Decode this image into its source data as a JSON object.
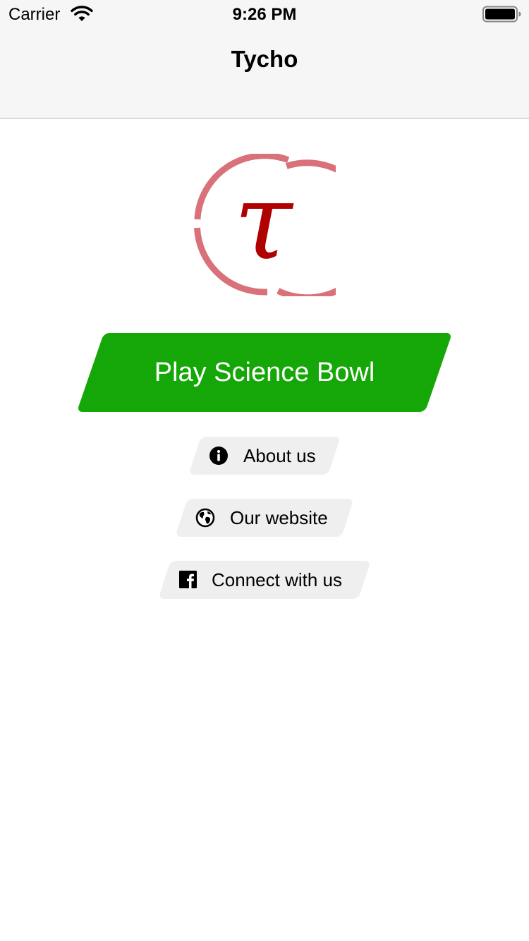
{
  "status_bar": {
    "carrier": "Carrier",
    "time": "9:26 PM"
  },
  "nav": {
    "title": "Tycho"
  },
  "logo": {
    "symbol": "τ",
    "ring_color": "#d9717a",
    "symbol_color": "#b00000"
  },
  "main": {
    "play_label": "Play Science Bowl",
    "play_color": "#15a707",
    "links": [
      {
        "label": "About us",
        "icon": "info-icon"
      },
      {
        "label": "Our website",
        "icon": "globe-icon"
      },
      {
        "label": "Connect with us",
        "icon": "facebook-icon"
      }
    ]
  }
}
